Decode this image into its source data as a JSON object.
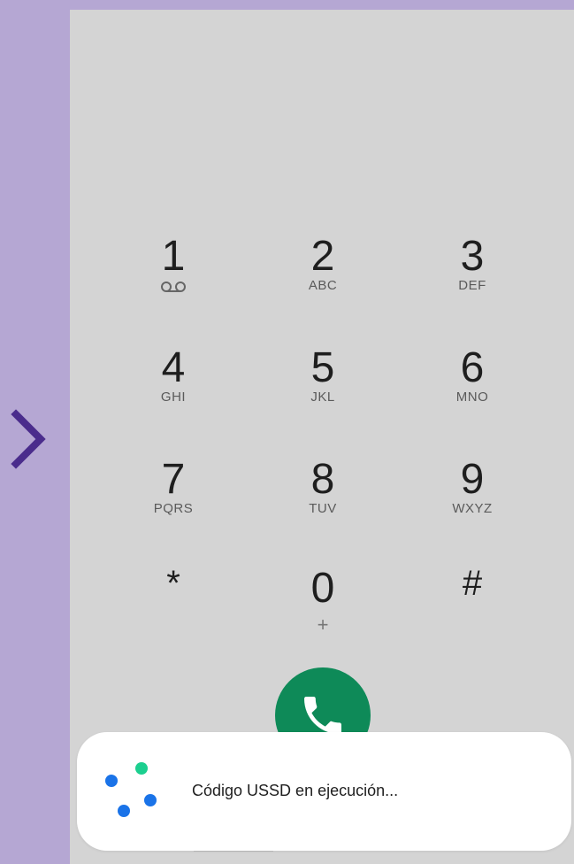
{
  "dialpad": {
    "keys": [
      {
        "digit": "1",
        "letters": "",
        "icon": "voicemail-icon"
      },
      {
        "digit": "2",
        "letters": "ABC"
      },
      {
        "digit": "3",
        "letters": "DEF"
      },
      {
        "digit": "4",
        "letters": "GHI"
      },
      {
        "digit": "5",
        "letters": "JKL"
      },
      {
        "digit": "6",
        "letters": "MNO"
      },
      {
        "digit": "7",
        "letters": "PQRS"
      },
      {
        "digit": "8",
        "letters": "TUV"
      },
      {
        "digit": "9",
        "letters": "WXYZ"
      },
      {
        "digit": "*",
        "letters": ""
      },
      {
        "digit": "0",
        "letters": "",
        "sub": "+"
      },
      {
        "digit": "#",
        "letters": ""
      }
    ]
  },
  "call_button": {
    "icon": "phone-icon",
    "color": "#0e8a58"
  },
  "toast": {
    "text": "Código USSD en ejecución...",
    "spinner_icon": "loading-dots-icon",
    "dot_colors": [
      "#1a73e8",
      "#1ccf8f"
    ]
  },
  "side": {
    "icon": "chevron-right-icon",
    "color": "#4a2c8c",
    "background": "#b5a7d3"
  }
}
